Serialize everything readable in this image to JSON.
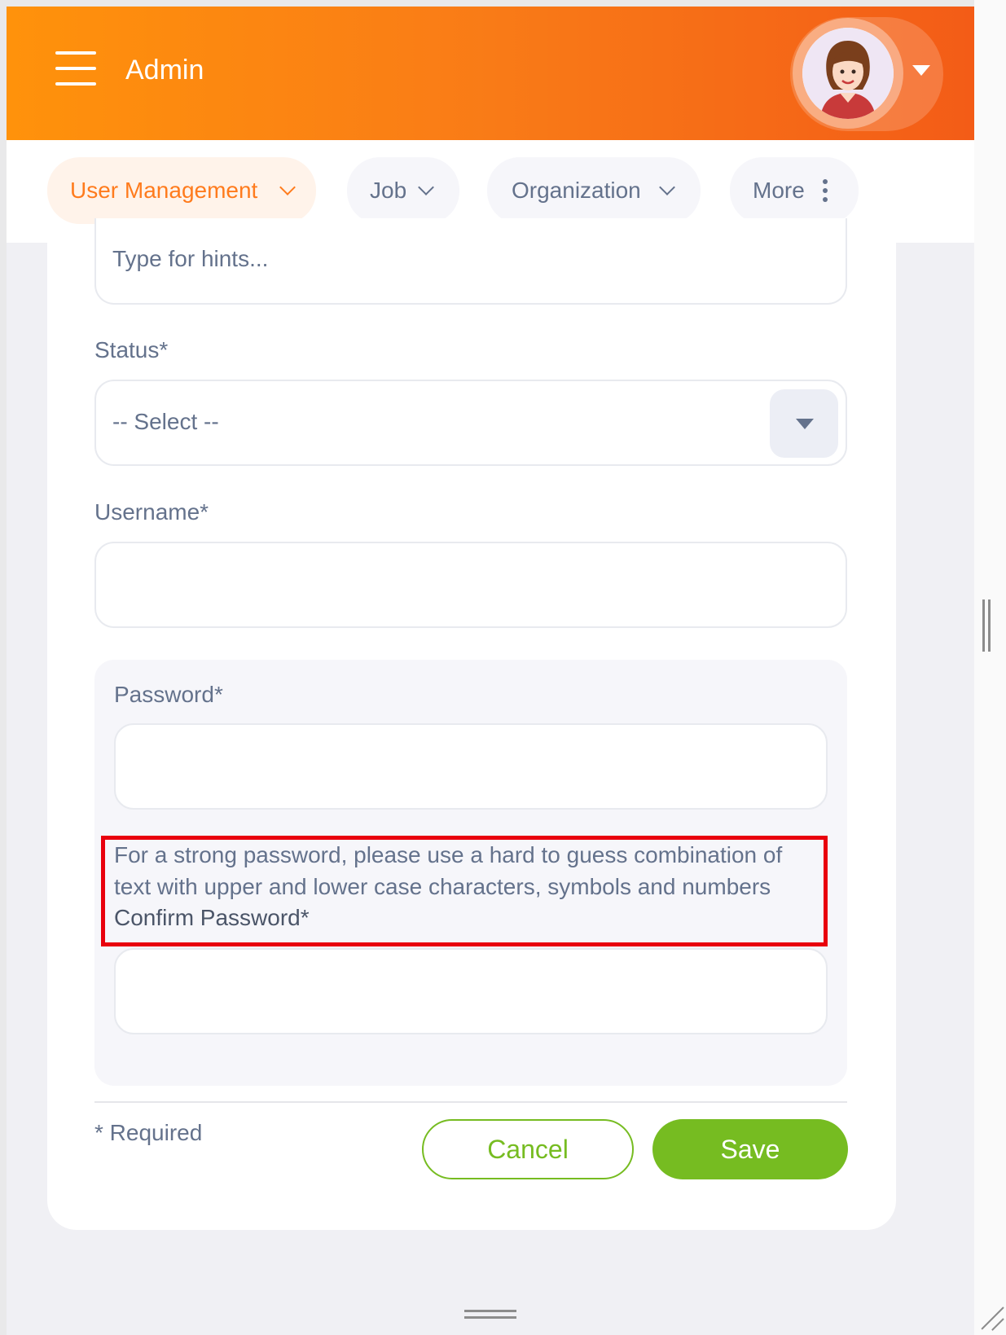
{
  "header": {
    "title": "Admin",
    "profile_icon": "user-avatar",
    "accent_gradient": [
      "#ff920b",
      "#f35c17"
    ]
  },
  "topnav": {
    "tabs": [
      {
        "label": "User Management",
        "active": true,
        "icon": "chevron-down-icon"
      },
      {
        "label": "Job",
        "active": false,
        "icon": "chevron-down-icon"
      },
      {
        "label": "Organization",
        "active": false,
        "icon": "chevron-down-icon"
      },
      {
        "label": "More",
        "active": false,
        "icon": "more-vertical-icon"
      }
    ],
    "active_color": "#ff7b1d"
  },
  "form": {
    "employee_name_placeholder": "Type for hints...",
    "status": {
      "label": "Status*",
      "value": "-- Select --"
    },
    "username": {
      "label": "Username*",
      "value": ""
    },
    "password": {
      "label": "Password*",
      "value": ""
    },
    "password_hint_line1": "For a strong password, please use a hard to guess combination of",
    "password_hint_line2": "text with upper and lower case characters, symbols and numbers",
    "confirm_password": {
      "label": "Confirm Password*",
      "value": ""
    },
    "required_note": "* Required",
    "cancel_label": "Cancel",
    "save_label": "Save",
    "button_color": "#76bc21",
    "highlight_color": "#e9000d"
  }
}
